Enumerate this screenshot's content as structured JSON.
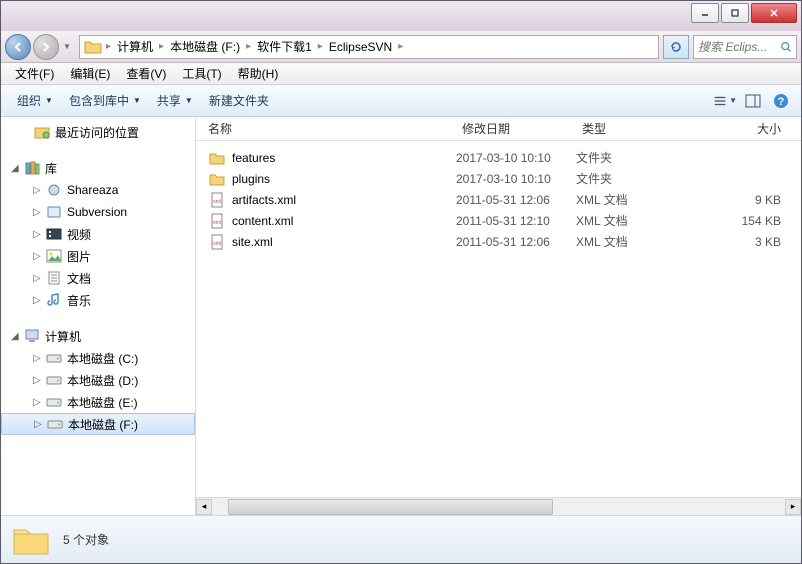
{
  "window_controls": {
    "min": "min",
    "max": "max",
    "close": "close"
  },
  "breadcrumb": [
    "计算机",
    "本地磁盘 (F:)",
    "软件下载1",
    "EclipseSVN"
  ],
  "search_placeholder": "搜索 Eclips...",
  "menubar": [
    "文件(F)",
    "编辑(E)",
    "查看(V)",
    "工具(T)",
    "帮助(H)"
  ],
  "toolbar": {
    "organize": "组织",
    "include": "包含到库中",
    "share": "共享",
    "newfolder": "新建文件夹"
  },
  "sidebar": {
    "recent": "最近访问的位置",
    "libraries": "库",
    "lib_items": [
      "Shareaza",
      "Subversion",
      "视频",
      "图片",
      "文档",
      "音乐"
    ],
    "computer": "计算机",
    "drives": [
      "本地磁盘 (C:)",
      "本地磁盘 (D:)",
      "本地磁盘 (E:)",
      "本地磁盘 (F:)"
    ]
  },
  "columns": {
    "name": "名称",
    "date": "修改日期",
    "type": "类型",
    "size": "大小"
  },
  "files": [
    {
      "name": "features",
      "date": "2017-03-10 10:10",
      "type": "文件夹",
      "size": "",
      "icon": "folder"
    },
    {
      "name": "plugins",
      "date": "2017-03-10 10:10",
      "type": "文件夹",
      "size": "",
      "icon": "folder"
    },
    {
      "name": "artifacts.xml",
      "date": "2011-05-31 12:06",
      "type": "XML 文档",
      "size": "9 KB",
      "icon": "xml"
    },
    {
      "name": "content.xml",
      "date": "2011-05-31 12:10",
      "type": "XML 文档",
      "size": "154 KB",
      "icon": "xml"
    },
    {
      "name": "site.xml",
      "date": "2011-05-31 12:06",
      "type": "XML 文档",
      "size": "3 KB",
      "icon": "xml"
    }
  ],
  "status": "5 个对象"
}
